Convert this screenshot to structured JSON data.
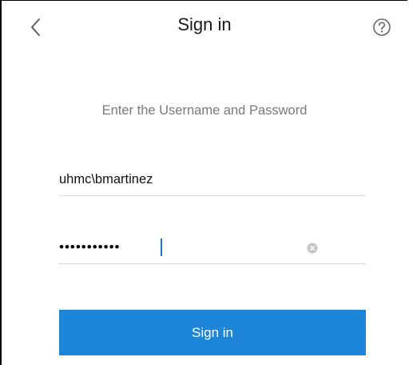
{
  "header": {
    "title": "Sign in",
    "back_icon": "chevron-left-icon",
    "help_icon": "question-circle-icon"
  },
  "form": {
    "instruction": "Enter the Username and Password",
    "username": {
      "value": "uhmc\\bmartinez"
    },
    "password": {
      "value": "•••••••••••",
      "clear_icon": "clear-circle-icon"
    },
    "submit_label": "Sign in"
  },
  "colors": {
    "primary_button": "#1e86d8",
    "button_text": "#ffffff",
    "instruction_text": "#7a7a7a",
    "divider": "#d9d9d9",
    "caret": "#1a73e8"
  }
}
